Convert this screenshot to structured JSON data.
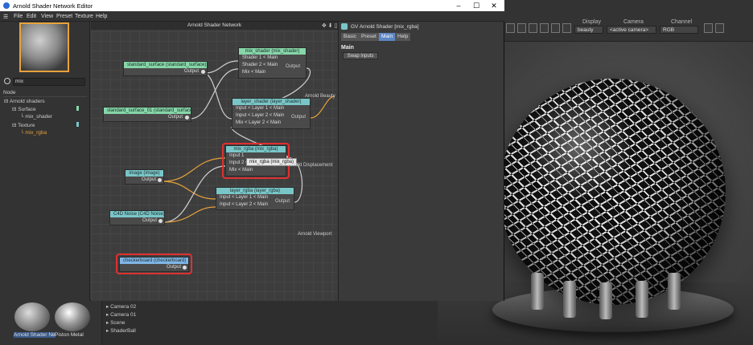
{
  "window": {
    "title": "Arnold Shader Network Editor",
    "minimize": "–",
    "maximize": "☐",
    "close": "✕"
  },
  "menu": [
    "File",
    "Edit",
    "View",
    "Preset",
    "Texture",
    "Help"
  ],
  "viewer": {
    "display_label": "Display",
    "display_value": "beauty",
    "camera_label": "Camera",
    "camera_value": "<active camera>",
    "channel_label": "Channel",
    "channel_value": "RGB"
  },
  "sidebar": {
    "search_value": "mix",
    "tree_header": "Node",
    "tree": [
      {
        "label": "Arnold shaders",
        "depth": 0,
        "prefix": "⊟ "
      },
      {
        "label": "Surface",
        "depth": 1,
        "prefix": "⊟ "
      },
      {
        "label": "mix_shader",
        "depth": 2,
        "prefix": "└ "
      },
      {
        "label": "Texture",
        "depth": 1,
        "prefix": "⊟ "
      },
      {
        "label": "mix_rgba",
        "depth": 2,
        "prefix": "└ "
      }
    ]
  },
  "canvas": {
    "title": "Arnold Shader Network",
    "icons": "✥ ⬇ ▯",
    "nodes": {
      "standard_surface": {
        "title": "standard_surface (standard_surface)",
        "rows": [
          "Output"
        ]
      },
      "standard_surface_01": {
        "title": "standard_surface_01 (standard_surface)",
        "rows": [
          "Output"
        ]
      },
      "mix_shader": {
        "title": "mix_shader (mix_shader)",
        "rows": [
          "Shader 1 < Main",
          "Shader 2 < Main",
          "Mix < Main"
        ],
        "output": "Output"
      },
      "layer_shader": {
        "title": "layer_shader (layer_shader)",
        "rows": [
          "Input < Layer 1 < Main",
          "Input < Layer 2 < Main",
          "Mix < Layer 2 < Main"
        ],
        "output": "Output"
      },
      "mix_rgba": {
        "title": "mix_rgba (mix_rgba)",
        "rows": [
          "Input 1",
          "Input 2 < Main",
          "Mix < Main"
        ],
        "output": "Output"
      },
      "image": {
        "title": "image (image)",
        "rows": [
          "Output"
        ]
      },
      "layer_rgba": {
        "title": "layer_rgba (layer_rgba)",
        "rows": [
          "Input < Layer 1 < Main",
          "Input < Layer 2 < Main"
        ],
        "output": "Output"
      },
      "c4d_noise": {
        "title": "C4D Noise (C4D Noise)",
        "rows": [
          "Output"
        ]
      },
      "checkerboard": {
        "title": "checkerboard (checkerboard)",
        "rows": [
          "Output"
        ]
      }
    },
    "outputs": {
      "beauty": "Arnold Beauty",
      "displacement": "Arnold Displacement",
      "viewport": "Arnold Viewport"
    },
    "tooltip": "mix_rgba (mix_rgba)"
  },
  "attributes": {
    "title": "GV Arnold Shader [mix_rgba]",
    "tabs": [
      "Basic",
      "Preset",
      "Main",
      "Help"
    ],
    "active_tab": "Main",
    "section": "Main",
    "button": "Swap inputs"
  },
  "materials": [
    "Arnold Shader Ne",
    "Piston Metal"
  ],
  "objects": [
    "Camera 02",
    "Camera 01",
    "Scene",
    "ShaderBall"
  ],
  "colors": {
    "accent": "#e8a23a",
    "highlight": "#e03030",
    "selected_tab": "#5d86c4",
    "header_green": "#86d6a8",
    "header_teal": "#79c6c8",
    "header_blue": "#7fb6e6"
  }
}
